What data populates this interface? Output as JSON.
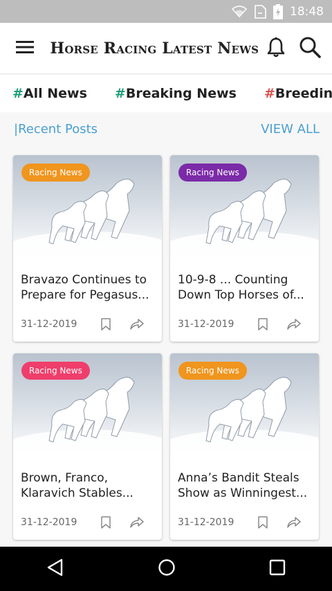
{
  "status": {
    "time": "18:48"
  },
  "appbar": {
    "title": "Horse Racing Latest News"
  },
  "tags": [
    "#All News",
    "#Breaking News",
    "#Breeding News"
  ],
  "tag_colors": [
    "#1f9e78",
    "#1f9e78",
    "#d9534f"
  ],
  "section": {
    "title": "|Recent Posts",
    "view_all": "VIEW ALL"
  },
  "posts": [
    {
      "category": "Racing News",
      "badge_color": "#f0951e",
      "title": "Bravazo Continues to Prepare for Pegasus...",
      "date": "31-12-2019"
    },
    {
      "category": "Racing News",
      "badge_color": "#7b2aa8",
      "title": "10-9-8 ... Counting Down Top Horses of...",
      "date": "31-12-2019"
    },
    {
      "category": "Racing News",
      "badge_color": "#ef3e6b",
      "title": "Brown, Franco, Klaravich Stables...",
      "date": "31-12-2019"
    },
    {
      "category": "Racing News",
      "badge_color": "#f0951e",
      "title": "Anna’s Bandit Steals Show as Winningest...",
      "date": "31-12-2019"
    }
  ],
  "icons": {
    "menu": "menu-icon",
    "bell": "bell-icon",
    "search": "search-icon",
    "bookmark": "bookmark-icon",
    "share": "share-icon",
    "back": "back-icon",
    "home": "home-icon",
    "recents": "recents-icon"
  }
}
